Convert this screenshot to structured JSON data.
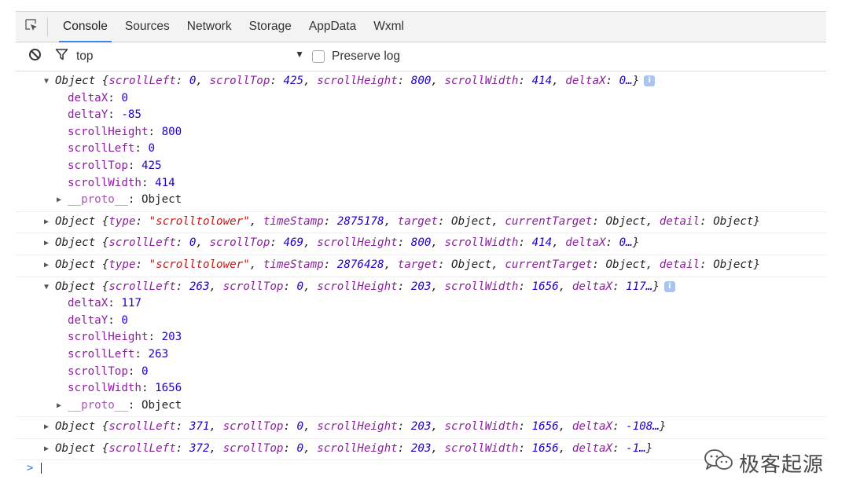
{
  "tabs": [
    {
      "label": "Console",
      "active": true
    },
    {
      "label": "Sources",
      "active": false
    },
    {
      "label": "Network",
      "active": false
    },
    {
      "label": "Storage",
      "active": false
    },
    {
      "label": "AppData",
      "active": false
    },
    {
      "label": "Wxml",
      "active": false
    }
  ],
  "toolbar": {
    "context_value": "top",
    "preserve_log_label": "Preserve log",
    "preserve_log_checked": false
  },
  "messages": [
    {
      "expanded": true,
      "type": "Object",
      "preview": [
        {
          "k": "scrollLeft",
          "v": "0",
          "t": "n"
        },
        {
          "k": "scrollTop",
          "v": "425",
          "t": "n"
        },
        {
          "k": "scrollHeight",
          "v": "800",
          "t": "n"
        },
        {
          "k": "scrollWidth",
          "v": "414",
          "t": "n"
        },
        {
          "k": "deltaX",
          "v": "0…",
          "t": "n"
        }
      ],
      "info_badge": "i",
      "props": [
        {
          "k": "deltaX",
          "v": "0"
        },
        {
          "k": "deltaY",
          "v": "-85"
        },
        {
          "k": "scrollHeight",
          "v": "800"
        },
        {
          "k": "scrollLeft",
          "v": "0"
        },
        {
          "k": "scrollTop",
          "v": "425"
        },
        {
          "k": "scrollWidth",
          "v": "414"
        }
      ],
      "proto": {
        "k": "__proto__",
        "v": "Object"
      }
    },
    {
      "expanded": false,
      "type": "Object",
      "preview": [
        {
          "k": "type",
          "v": "\"scrolltolower\"",
          "t": "s"
        },
        {
          "k": "timeStamp",
          "v": "2875178",
          "t": "n"
        },
        {
          "k": "target",
          "v": "Object",
          "t": "o"
        },
        {
          "k": "currentTarget",
          "v": "Object",
          "t": "o"
        },
        {
          "k": "detail",
          "v": "Object",
          "t": "o"
        }
      ],
      "closed": true
    },
    {
      "expanded": false,
      "type": "Object",
      "preview": [
        {
          "k": "scrollLeft",
          "v": "0",
          "t": "n"
        },
        {
          "k": "scrollTop",
          "v": "469",
          "t": "n"
        },
        {
          "k": "scrollHeight",
          "v": "800",
          "t": "n"
        },
        {
          "k": "scrollWidth",
          "v": "414",
          "t": "n"
        },
        {
          "k": "deltaX",
          "v": "0…",
          "t": "n"
        }
      ]
    },
    {
      "expanded": false,
      "type": "Object",
      "preview": [
        {
          "k": "type",
          "v": "\"scrolltolower\"",
          "t": "s"
        },
        {
          "k": "timeStamp",
          "v": "2876428",
          "t": "n"
        },
        {
          "k": "target",
          "v": "Object",
          "t": "o"
        },
        {
          "k": "currentTarget",
          "v": "Object",
          "t": "o"
        },
        {
          "k": "detail",
          "v": "Object",
          "t": "o"
        }
      ],
      "closed": true
    },
    {
      "expanded": true,
      "type": "Object",
      "preview": [
        {
          "k": "scrollLeft",
          "v": "263",
          "t": "n"
        },
        {
          "k": "scrollTop",
          "v": "0",
          "t": "n"
        },
        {
          "k": "scrollHeight",
          "v": "203",
          "t": "n"
        },
        {
          "k": "scrollWidth",
          "v": "1656",
          "t": "n"
        },
        {
          "k": "deltaX",
          "v": "117…",
          "t": "n"
        }
      ],
      "info_badge": "i",
      "props": [
        {
          "k": "deltaX",
          "v": "117"
        },
        {
          "k": "deltaY",
          "v": "0"
        },
        {
          "k": "scrollHeight",
          "v": "203"
        },
        {
          "k": "scrollLeft",
          "v": "263"
        },
        {
          "k": "scrollTop",
          "v": "0"
        },
        {
          "k": "scrollWidth",
          "v": "1656"
        }
      ],
      "proto": {
        "k": "__proto__",
        "v": "Object"
      }
    },
    {
      "expanded": false,
      "type": "Object",
      "preview": [
        {
          "k": "scrollLeft",
          "v": "371",
          "t": "n"
        },
        {
          "k": "scrollTop",
          "v": "0",
          "t": "n"
        },
        {
          "k": "scrollHeight",
          "v": "203",
          "t": "n"
        },
        {
          "k": "scrollWidth",
          "v": "1656",
          "t": "n"
        },
        {
          "k": "deltaX",
          "v": "-108…",
          "t": "n"
        }
      ]
    },
    {
      "expanded": false,
      "type": "Object",
      "preview": [
        {
          "k": "scrollLeft",
          "v": "372",
          "t": "n"
        },
        {
          "k": "scrollTop",
          "v": "0",
          "t": "n"
        },
        {
          "k": "scrollHeight",
          "v": "203",
          "t": "n"
        },
        {
          "k": "scrollWidth",
          "v": "1656",
          "t": "n"
        },
        {
          "k": "deltaX",
          "v": "-1…",
          "t": "n"
        }
      ]
    }
  ],
  "prompt_symbol": ">",
  "watermark": {
    "text": "极客起源",
    "icon": "wechat-icon"
  },
  "icons": {
    "inspect": "inspect-element-icon",
    "clear": "clear-console-icon",
    "filter": "filter-icon",
    "dropdown": "dropdown-arrow-icon",
    "expand": "triangle-expand-icon",
    "info": "info-badge-icon"
  },
  "colors": {
    "key": "#8a1f9c",
    "number": "#1c00cf",
    "string": "#c41a16",
    "tab_indicator": "#3f82f0",
    "info_badge": "#aac4f2"
  }
}
